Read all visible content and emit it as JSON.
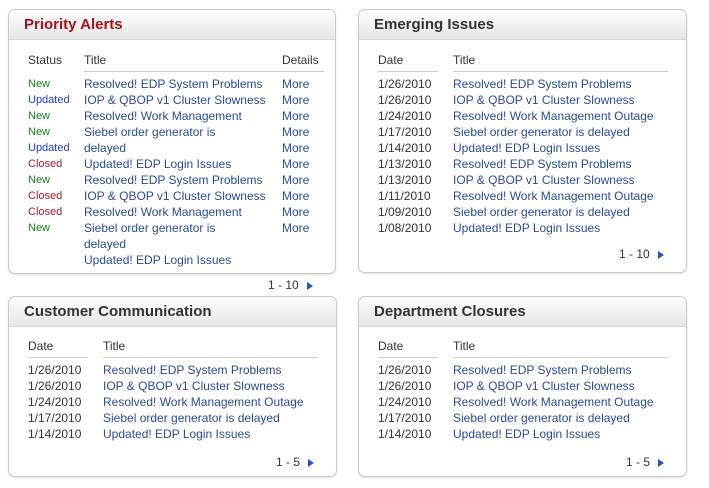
{
  "priority_alerts": {
    "title": "Priority Alerts",
    "headers": {
      "status": "Status",
      "title": "Title",
      "details": "Details"
    },
    "statuses": [
      "New",
      "Updated",
      "New",
      "New",
      "Updated",
      "Closed",
      "New",
      "Closed",
      "Closed",
      "New"
    ],
    "titles": [
      "Resolved! EDP System Problems",
      "IOP & QBOP v1 Cluster Slowness",
      "Resolved! Work Management",
      "Siebel order generator is",
      "delayed",
      "Updated! EDP Login Issues",
      "Resolved! EDP System Problems",
      "IOP & QBOP v1 Cluster Slowness",
      "Resolved! Work Management",
      "Siebel order generator is",
      "delayed",
      "Updated! EDP Login Issues"
    ],
    "details": [
      "More",
      "More",
      "More",
      "More",
      "More",
      "More",
      "More",
      "More",
      "More",
      "More"
    ],
    "pager": "1 - 10"
  },
  "emerging_issues": {
    "title": "Emerging Issues",
    "headers": {
      "date": "Date",
      "title": "Title"
    },
    "rows": [
      {
        "date": "1/26/2010",
        "title": "Resolved! EDP System Problems"
      },
      {
        "date": "1/26/2010",
        "title": "IOP & QBOP v1 Cluster Slowness"
      },
      {
        "date": "1/24/2010",
        "title": "Resolved! Work Management Outage"
      },
      {
        "date": "1/17/2010",
        "title": "Siebel order generator is delayed"
      },
      {
        "date": "1/14/2010",
        "title": "Updated! EDP Login Issues"
      },
      {
        "date": "1/13/2010",
        "title": "Resolved! EDP System Problems"
      },
      {
        "date": "1/13/2010",
        "title": "IOP & QBOP v1 Cluster Slowness"
      },
      {
        "date": "1/11/2010",
        "title": "Resolved! Work Management Outage"
      },
      {
        "date": "1/09/2010",
        "title": "Siebel order generator is delayed"
      },
      {
        "date": "1/08/2010",
        "title": "Updated! EDP Login Issues"
      }
    ],
    "pager": "1 - 10"
  },
  "customer_communication": {
    "title": "Customer Communication",
    "headers": {
      "date": "Date",
      "title": "Title"
    },
    "rows": [
      {
        "date": "1/26/2010",
        "title": "Resolved! EDP System Problems"
      },
      {
        "date": "1/26/2010",
        "title": "IOP & QBOP v1 Cluster Slowness"
      },
      {
        "date": "1/24/2010",
        "title": "Resolved! Work Management Outage"
      },
      {
        "date": "1/17/2010",
        "title": "Siebel order generator is delayed"
      },
      {
        "date": "1/14/2010",
        "title": "Updated! EDP Login Issues"
      }
    ],
    "pager": "1 - 5"
  },
  "department_closures": {
    "title": "Department Closures",
    "headers": {
      "date": "Date",
      "title": "Title"
    },
    "rows": [
      {
        "date": "1/26/2010",
        "title": "Resolved! EDP System Problems"
      },
      {
        "date": "1/26/2010",
        "title": "IOP & QBOP v1 Cluster Slowness"
      },
      {
        "date": "1/24/2010",
        "title": "Resolved! Work Management Outage"
      },
      {
        "date": "1/17/2010",
        "title": "Siebel order generator is delayed"
      },
      {
        "date": "1/14/2010",
        "title": "Updated! EDP Login Issues"
      }
    ],
    "pager": "1 - 5"
  },
  "colors": {
    "alert_title": "#a4121c",
    "link": "#2a4a9a",
    "status_new": "#1c7a1c",
    "status_updated": "#1c3fbf",
    "status_closed": "#b0171e",
    "pager_arrow": "#2a52c0"
  }
}
